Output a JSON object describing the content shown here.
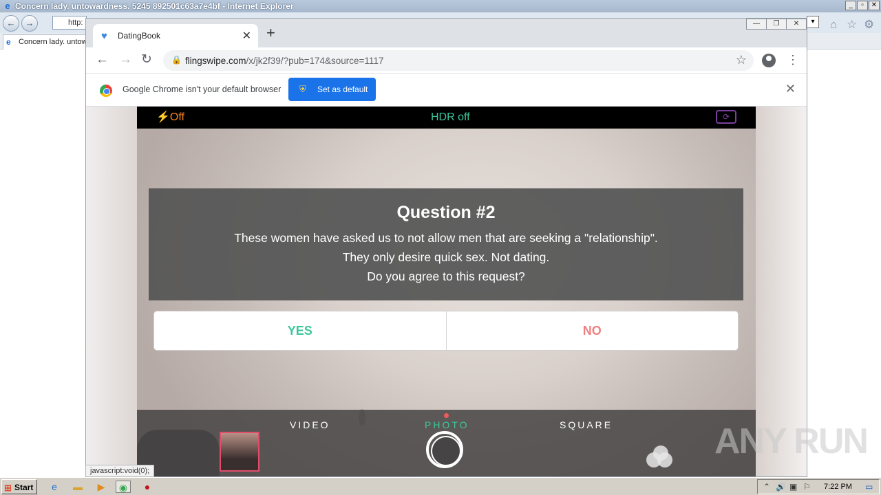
{
  "ie": {
    "window_title": "Concern lady. untowardness. 5245 892501c63a7e4bf - Internet Explorer",
    "address_partial": "http:",
    "tab_title": "Concern lady. untow"
  },
  "chrome": {
    "tab_title": "DatingBook",
    "url_host": "flingswipe.com",
    "url_path": "/x/jk2f39/?pub=174&source=1117",
    "infobar_message": "Google Chrome isn't your default browser",
    "set_default_label": "Set as default"
  },
  "camera": {
    "flash_label": "Off",
    "hdr_label": "HDR off",
    "modes": [
      "VIDEO",
      "PHOTO",
      "SQUARE"
    ],
    "active_mode": "PHOTO",
    "accent_color": "#3bc79b"
  },
  "question": {
    "title": "Question #2",
    "line1": "These women have asked us to not allow men that are seeking a \"relationship\".",
    "line2": "They only desire quick sex. Not dating.",
    "line3": "Do you agree to this request?",
    "yes_label": "YES",
    "no_label": "NO"
  },
  "statusbar": {
    "text": "javascript:void(0);"
  },
  "watermark": {
    "text": "ANY RUN"
  },
  "taskbar": {
    "start_label": "Start",
    "time": "7:22 PM"
  }
}
